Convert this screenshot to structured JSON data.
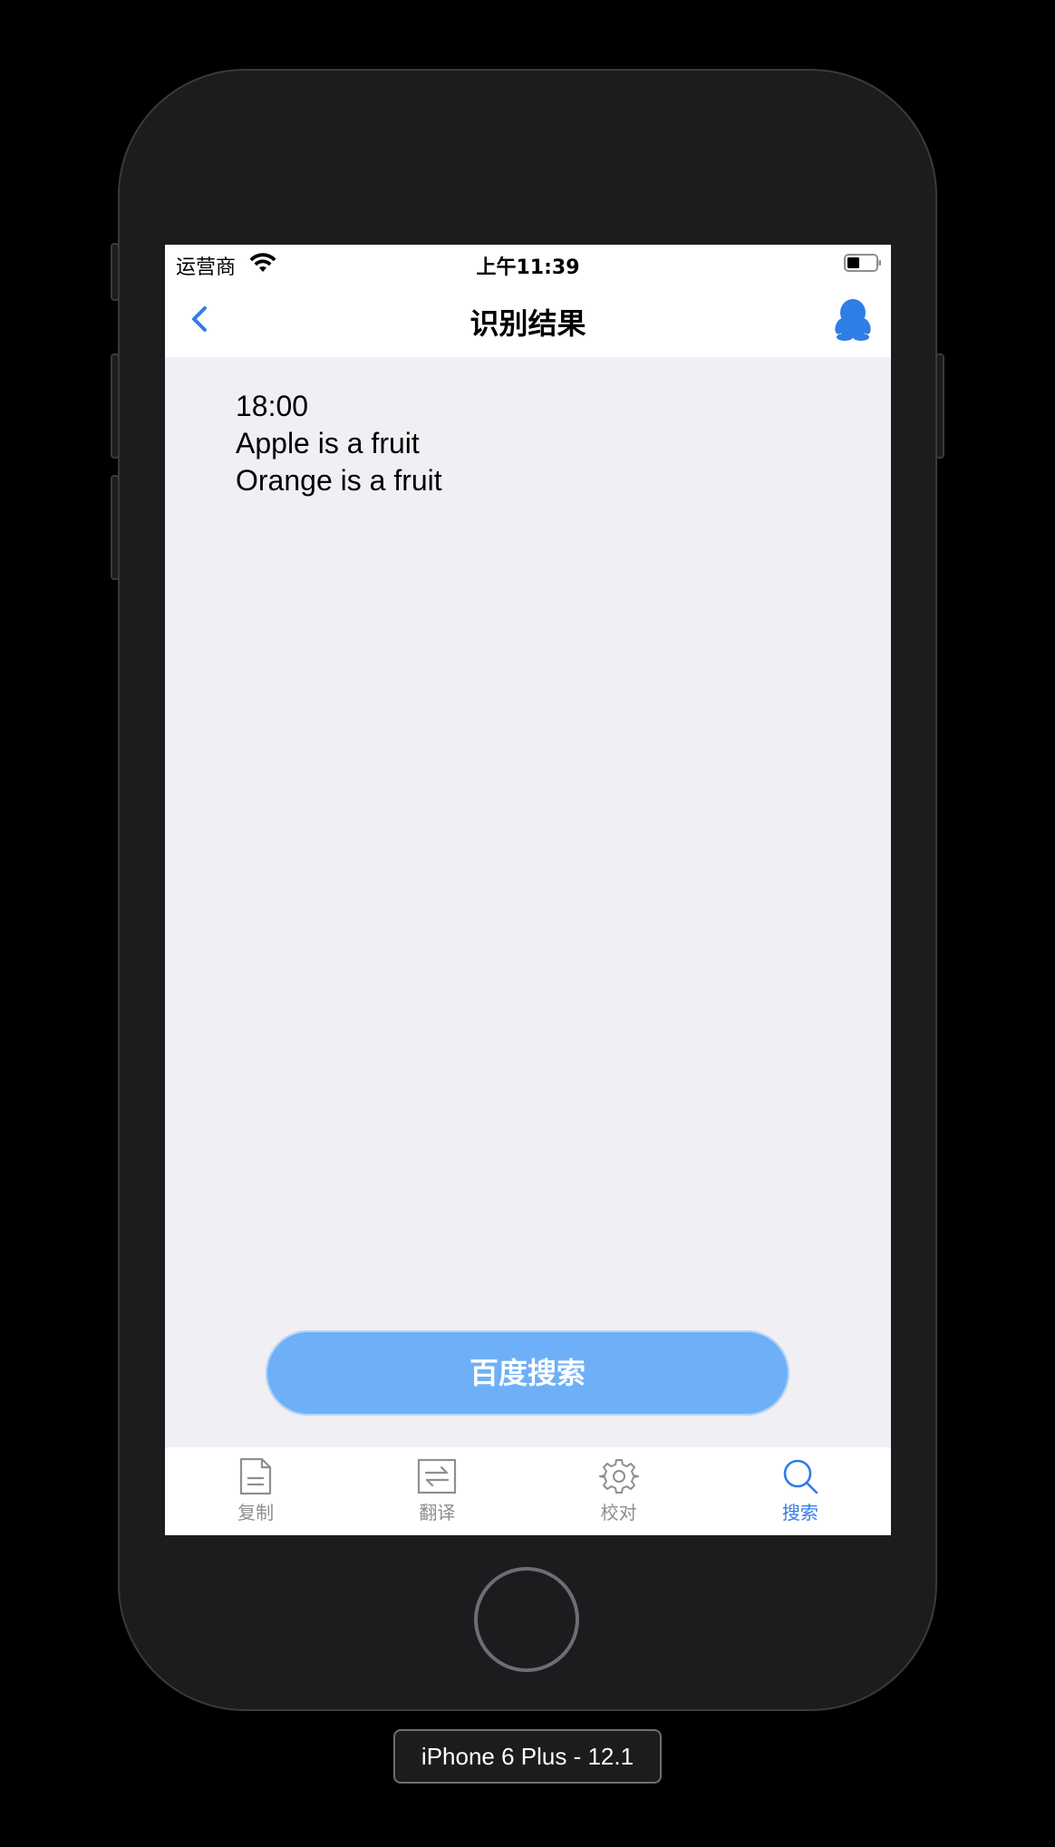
{
  "status_bar": {
    "carrier": "运营商",
    "time": "上午11:39"
  },
  "nav_bar": {
    "title": "识别结果",
    "back_icon": "chevron-left-icon",
    "right_icon": "qq-penguin-icon"
  },
  "result": {
    "lines": [
      "18:00",
      "Apple is a fruit",
      "Orange is a fruit"
    ]
  },
  "search_button": {
    "label": "百度搜索"
  },
  "tabs": [
    {
      "label": "复制",
      "icon": "document-icon",
      "active": false
    },
    {
      "label": "翻译",
      "icon": "translate-arrows-icon",
      "active": false
    },
    {
      "label": "校对",
      "icon": "gear-icon",
      "active": false
    },
    {
      "label": "搜索",
      "icon": "search-icon",
      "active": true
    }
  ],
  "device": {
    "label": "iPhone 6 Plus - 12.1"
  },
  "colors": {
    "accent": "#2f7de6",
    "button": "#6eb0f7",
    "background": "#efeff4",
    "tab_inactive": "#8e8e93"
  }
}
